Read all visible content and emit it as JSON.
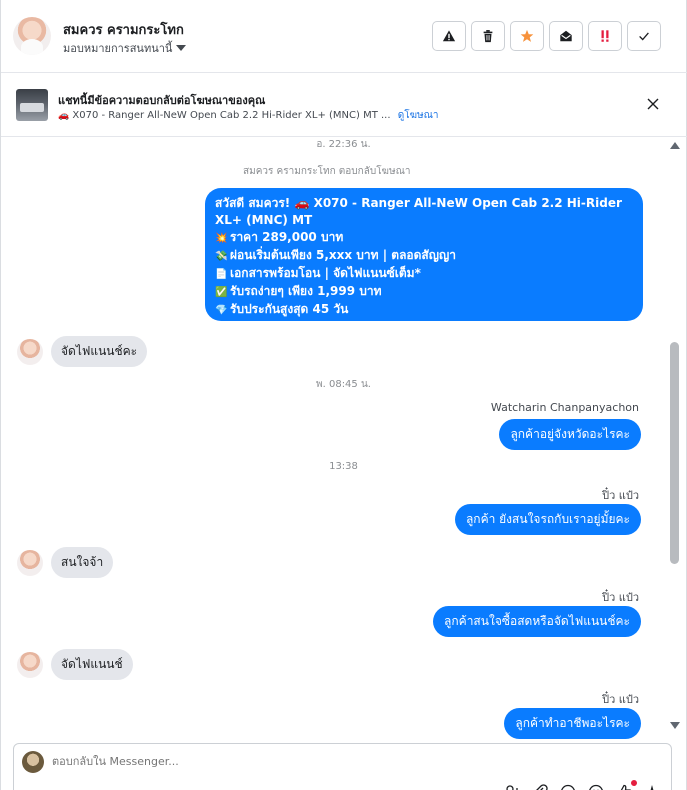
{
  "header": {
    "contact_name": "สมควร ครามกระโทก",
    "assign_label": "มอบหมายการสนทนานี้",
    "actions": [
      {
        "icon": "warning-icon"
      },
      {
        "icon": "trash-icon"
      },
      {
        "icon": "star-icon"
      },
      {
        "icon": "mark-unread-icon"
      },
      {
        "icon": "follow-up-icon"
      },
      {
        "icon": "check-icon"
      }
    ]
  },
  "ad_banner": {
    "title": "แชทนี้มีข้อความตอบกลับต่อโฆษณาของคุณ",
    "car_emoji": "🚗",
    "subtitle": "X070 - Ranger All-NeW Open Cab 2.2 Hi-Rider XL+ (MNC) MT ...",
    "link": "ดูโฆษณา"
  },
  "thread": {
    "stamp_1": "อ. 22:36 น.",
    "replied_note": "สมควร ครามกระโทก ตอบกลับโฆษณา",
    "ad_message": [
      {
        "emoji": "",
        "text": "สวัสดี สมควร! 🚗 X070 - Ranger All-NeW Open Cab 2.2 Hi-Rider XL+ (MNC) MT"
      },
      {
        "emoji": "💥",
        "text": "ราคา 289,000 บาท"
      },
      {
        "emoji": "💸",
        "text": "ผ่อนเริ่มต้นเพียง 5,xxx บาท | ตลอดสัญญา"
      },
      {
        "emoji": "📄",
        "text": "เอกสารพร้อมโอน | จัดไฟแนนซ์เต็ม*"
      },
      {
        "emoji": "✅",
        "text": "รับรถง่ายๆ เพียง 1,999 บาท"
      },
      {
        "emoji": "💎",
        "text": "รับประกันสูงสุด 45 วัน"
      }
    ],
    "incoming_1": "จัดไฟแนนช์คะ",
    "stamp_2": "พ. 08:45 น.",
    "sender_1": "Watcharin Chanpanyachon",
    "outgoing_1": "ลูกค้าอยู่จังหวัดอะไรคะ",
    "stamp_3": "13:38",
    "sender_2": "ปิ๋ว แป๋ว",
    "outgoing_2": "ลูกค้า ยังสนใจรถกับเราอยู่มั้ยคะ",
    "incoming_2": "สนใจจ้า",
    "sender_3": "ปิ๋ว แป๋ว",
    "outgoing_3": "ลูกค้าสนใจซื้อสดหรือจัดไฟแนนช์คะ",
    "incoming_3": "จัดไฟแนนช์",
    "sender_4": "ปิ๋ว แป๋ว",
    "outgoing_4": "ลูกค้าทำอาชีพอะไรคะ"
  },
  "composer": {
    "placeholder": "ตอบกลับใน Messenger..."
  },
  "colors": {
    "accent": "#0a7cff",
    "star": "#f7923b",
    "follow_up": "#e41e3f",
    "incoming_bubble": "#e4e6eb"
  }
}
